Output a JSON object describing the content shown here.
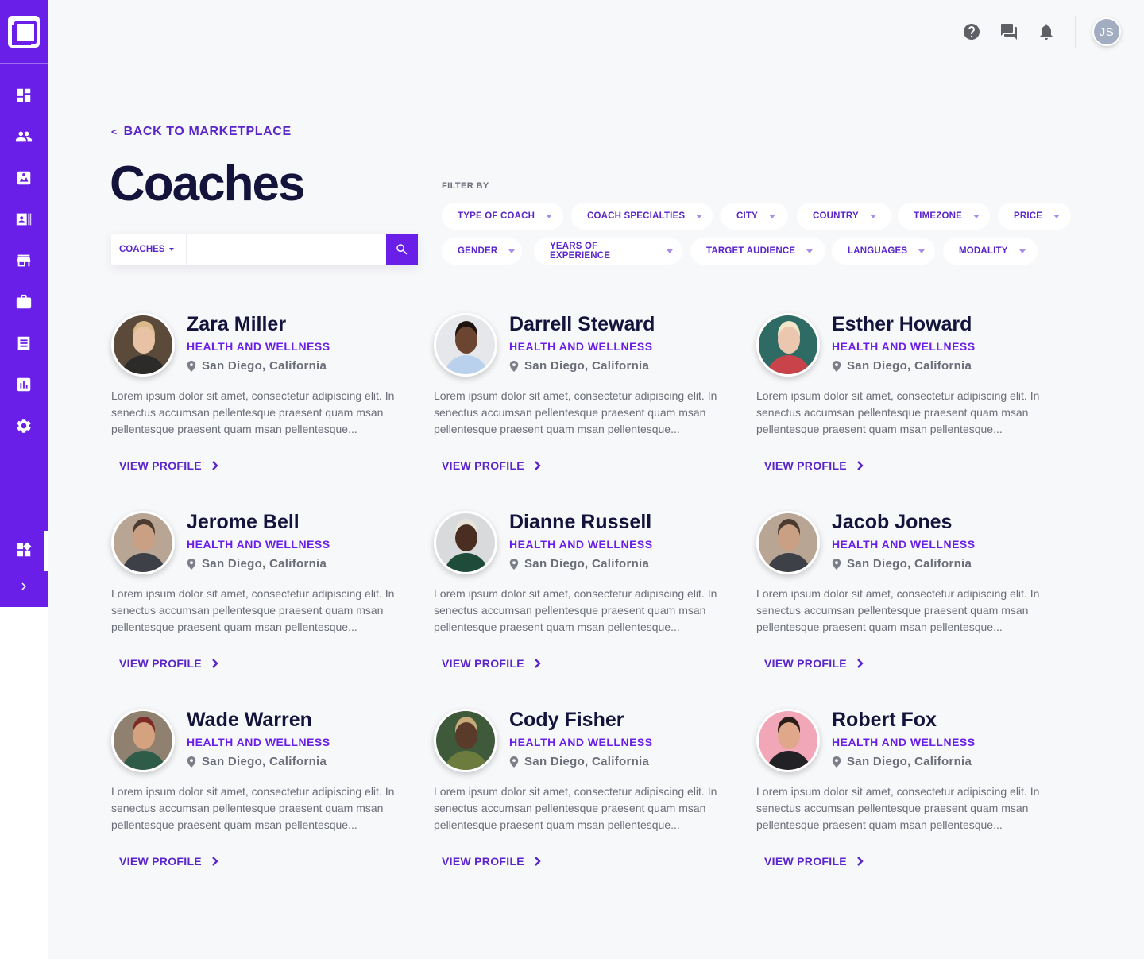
{
  "app": {
    "user_initials": "JS"
  },
  "back_link": "BACK TO MARKETPLACE",
  "page_title": "Coaches",
  "search": {
    "type_label": "COACHES",
    "value": "",
    "placeholder": ""
  },
  "filters": {
    "label": "FILTER BY",
    "items": [
      "TYPE OF COACH",
      "COACH SPECIALTIES",
      "CITY",
      "COUNTRY",
      "TIMEZONE",
      "PRICE",
      "GENDER",
      "YEARS OF EXPERIENCE",
      "TARGET AUDIENCE",
      "LANGUAGES",
      "MODALITY"
    ]
  },
  "coaches": [
    {
      "name": "Zara Miller",
      "specialty": "HEALTH AND WELLNESS",
      "location": "San Diego, California",
      "description": "Lorem ipsum dolor sit amet, consectetur adipiscing elit. In senectus accumsan pellentesque praesent quam msan pellentesque  praesent quam msan pellentesque...",
      "view_label": "VIEW PROFILE",
      "photo_colors": {
        "bg": "#5b4a3a",
        "skin": "#e8c2a4",
        "shirt": "#2d2a2a",
        "hair": "#d9b98a"
      }
    },
    {
      "name": "Darrell Steward",
      "specialty": "HEALTH AND WELLNESS",
      "location": "San Diego, California",
      "description": "Lorem ipsum dolor sit amet, consectetur adipiscing elit. In senectus accumsan pellentesque praesent quam msan pellentesque  praesent quam msan pellentesque...",
      "view_label": "VIEW PROFILE",
      "photo_colors": {
        "bg": "#e6e7ea",
        "skin": "#6b4530",
        "shirt": "#b9d1ec",
        "hair": "#1d1410"
      }
    },
    {
      "name": "Esther Howard",
      "specialty": "HEALTH AND WELLNESS",
      "location": "San Diego, California",
      "description": "Lorem ipsum dolor sit amet, consectetur adipiscing elit. In senectus accumsan pellentesque praesent quam msan pellentesque  praesent quam msan pellentesque...",
      "view_label": "VIEW PROFILE",
      "photo_colors": {
        "bg": "#2e6b64",
        "skin": "#ecc7b0",
        "shirt": "#c9444a",
        "hair": "#f1e6c8"
      }
    },
    {
      "name": "Jerome Bell",
      "specialty": "HEALTH AND WELLNESS",
      "location": "San Diego, California",
      "description": "Lorem ipsum dolor sit amet, consectetur adipiscing elit. In senectus accumsan pellentesque praesent quam msan pellentesque  praesent quam msan pellentesque...",
      "view_label": "VIEW PROFILE",
      "photo_colors": {
        "bg": "#b8a594",
        "skin": "#caa085",
        "shirt": "#3d4046",
        "hair": "#4a3a30"
      }
    },
    {
      "name": "Dianne Russell",
      "specialty": "HEALTH AND WELLNESS",
      "location": "San Diego, California",
      "description": "Lorem ipsum dolor sit amet, consectetur adipiscing elit. In senectus accumsan pellentesque praesent quam msan pellentesque  praesent quam msan pellentesque...",
      "view_label": "VIEW PROFILE",
      "photo_colors": {
        "bg": "#d9dadc",
        "skin": "#4a2e22",
        "shirt": "#1f4b3a",
        "hair": "#e9e4d9"
      }
    },
    {
      "name": "Jacob Jones",
      "specialty": "HEALTH AND WELLNESS",
      "location": "San Diego, California",
      "description": "Lorem ipsum dolor sit amet, consectetur adipiscing elit. In senectus accumsan pellentesque praesent quam msan pellentesque  praesent quam msan pellentesque...",
      "view_label": "VIEW PROFILE",
      "photo_colors": {
        "bg": "#b8a594",
        "skin": "#caa085",
        "shirt": "#3d4046",
        "hair": "#4a3a30"
      }
    },
    {
      "name": "Wade Warren",
      "specialty": "HEALTH AND WELLNESS",
      "location": "San Diego, California",
      "description": "Lorem ipsum dolor sit amet, consectetur adipiscing elit. In senectus accumsan pellentesque praesent quam msan pellentesque  praesent quam msan pellentesque...",
      "view_label": "VIEW PROFILE",
      "photo_colors": {
        "bg": "#8f8070",
        "skin": "#d4a27e",
        "shirt": "#2f5b49",
        "hair": "#7c2a26"
      }
    },
    {
      "name": "Cody Fisher",
      "specialty": "HEALTH AND WELLNESS",
      "location": "San Diego, California",
      "description": "Lorem ipsum dolor sit amet, consectetur adipiscing elit. In senectus accumsan pellentesque praesent quam msan pellentesque  praesent quam msan pellentesque...",
      "view_label": "VIEW PROFILE",
      "photo_colors": {
        "bg": "#3e5a3a",
        "skin": "#5a3b2a",
        "shirt": "#6b7c3e",
        "hair": "#c7ab7a"
      }
    },
    {
      "name": "Robert Fox",
      "specialty": "HEALTH AND WELLNESS",
      "location": "San Diego, California",
      "description": "Lorem ipsum dolor sit amet, consectetur adipiscing elit. In senectus accumsan pellentesque praesent quam msan pellentesque  praesent quam msan pellentesque...",
      "view_label": "VIEW PROFILE",
      "photo_colors": {
        "bg": "#f1a7b8",
        "skin": "#e0a88a",
        "shirt": "#222226",
        "hair": "#2a1d18"
      }
    }
  ],
  "sidebar": {
    "items": [
      "dashboard-icon",
      "people-icon",
      "image-icon",
      "contacts-icon",
      "store-icon",
      "briefcase-icon",
      "list-icon",
      "analytics-icon",
      "settings-icon",
      "widgets-icon",
      "chevron-right-icon"
    ]
  },
  "colors": {
    "accent": "#6a1fe8",
    "accent_text": "#5a25c9",
    "title": "#14133b",
    "muted": "#6b6d78",
    "background": "#f7f8fa"
  }
}
